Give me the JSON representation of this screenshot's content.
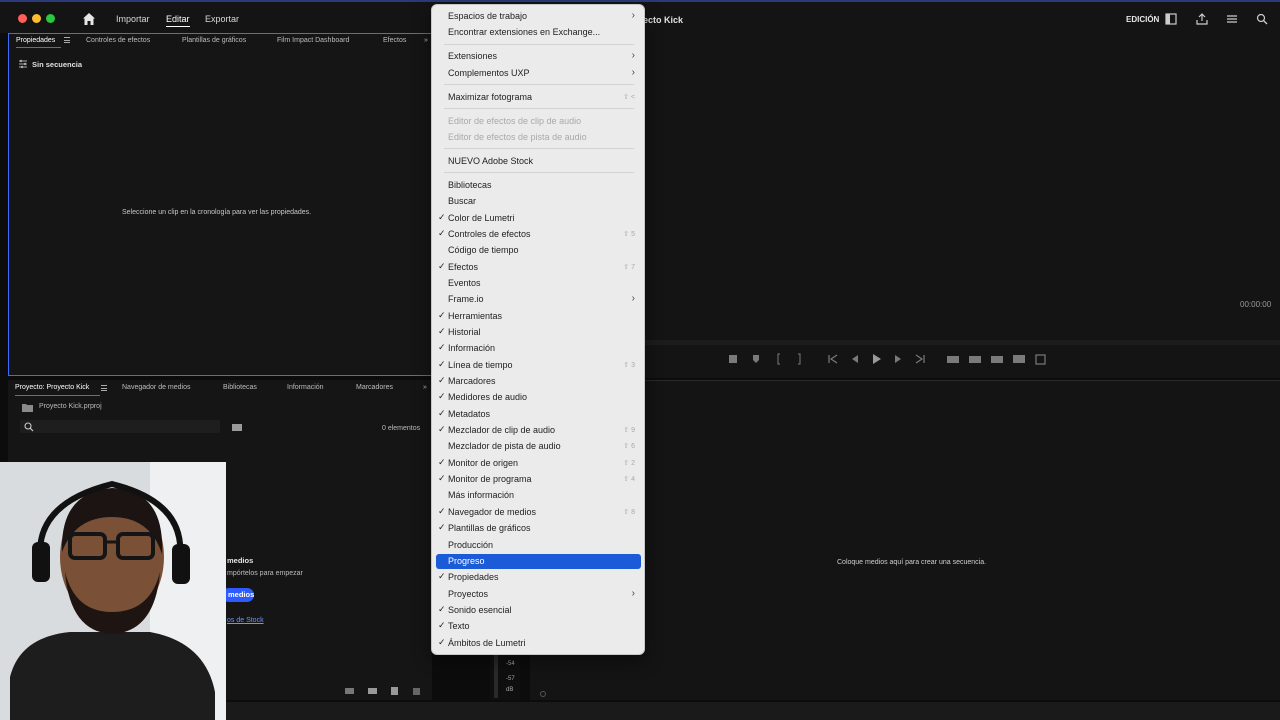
{
  "topbar": {
    "nav": [
      "Importar",
      "Editar",
      "Exportar"
    ],
    "title": "yecto Kick",
    "workspace": "EDICIÓN"
  },
  "props_panel": {
    "tabs": [
      "Propiedades",
      "Controles de efectos",
      "Plantillas de gráficos",
      "Film Impact Dashboard",
      "Efectos"
    ],
    "no_sequence": "Sin secuencia",
    "hint": "Seleccione un clip en la cronología para ver las propiedades."
  },
  "project_panel": {
    "tabs": [
      "Proyecto: Proyecto Kick",
      "Navegador de medios",
      "Bibliotecas",
      "Información",
      "Marcadores"
    ],
    "file": "Proyecto Kick.prproj",
    "count": "0 elementos",
    "empty_title": "medios",
    "empty_sub": "mpórtelos para empezar",
    "button": "medios",
    "link": "os de Stock"
  },
  "program": {
    "timecode": "00:00:00"
  },
  "timeline": {
    "hint": "Coloque medios aquí para crear una secuencia.",
    "meter_labels": [
      "-54",
      "-57",
      "dB"
    ]
  },
  "menu": {
    "items": [
      {
        "label": "Espacios de trabajo",
        "check": false,
        "arrow": true,
        "shortcut": "",
        "disabled": false,
        "highlight": false
      },
      {
        "label": "Encontrar extensiones en Exchange...",
        "check": false,
        "arrow": false,
        "shortcut": "",
        "disabled": false,
        "highlight": false
      },
      {
        "label": "Extensiones",
        "check": false,
        "arrow": true,
        "shortcut": "",
        "disabled": false,
        "highlight": false
      },
      {
        "label": "Complementos UXP",
        "check": false,
        "arrow": true,
        "shortcut": "",
        "disabled": false,
        "highlight": false
      },
      {
        "label": "Maximizar fotograma",
        "check": false,
        "arrow": false,
        "shortcut": "⇧ <",
        "disabled": false,
        "highlight": false
      },
      {
        "label": "Editor de efectos de clip de audio",
        "check": false,
        "arrow": false,
        "shortcut": "",
        "disabled": true,
        "highlight": false
      },
      {
        "label": "Editor de efectos de pista de audio",
        "check": false,
        "arrow": false,
        "shortcut": "",
        "disabled": true,
        "highlight": false
      },
      {
        "label": "NUEVO Adobe Stock",
        "check": false,
        "arrow": false,
        "shortcut": "",
        "disabled": false,
        "highlight": false
      },
      {
        "label": "Bibliotecas",
        "check": false,
        "arrow": false,
        "shortcut": "",
        "disabled": false,
        "highlight": false
      },
      {
        "label": "Buscar",
        "check": false,
        "arrow": false,
        "shortcut": "",
        "disabled": false,
        "highlight": false
      },
      {
        "label": "Color de Lumetri",
        "check": true,
        "arrow": false,
        "shortcut": "",
        "disabled": false,
        "highlight": false
      },
      {
        "label": "Controles de efectos",
        "check": true,
        "arrow": false,
        "shortcut": "⇧ 5",
        "disabled": false,
        "highlight": false
      },
      {
        "label": "Código de tiempo",
        "check": false,
        "arrow": false,
        "shortcut": "",
        "disabled": false,
        "highlight": false
      },
      {
        "label": "Efectos",
        "check": true,
        "arrow": false,
        "shortcut": "⇧ 7",
        "disabled": false,
        "highlight": false
      },
      {
        "label": "Eventos",
        "check": false,
        "arrow": false,
        "shortcut": "",
        "disabled": false,
        "highlight": false
      },
      {
        "label": "Frame.io",
        "check": false,
        "arrow": true,
        "shortcut": "",
        "disabled": false,
        "highlight": false
      },
      {
        "label": "Herramientas",
        "check": true,
        "arrow": false,
        "shortcut": "",
        "disabled": false,
        "highlight": false
      },
      {
        "label": "Historial",
        "check": true,
        "arrow": false,
        "shortcut": "",
        "disabled": false,
        "highlight": false
      },
      {
        "label": "Información",
        "check": true,
        "arrow": false,
        "shortcut": "",
        "disabled": false,
        "highlight": false
      },
      {
        "label": "Línea de tiempo",
        "check": true,
        "arrow": false,
        "shortcut": "⇧ 3",
        "disabled": false,
        "highlight": false
      },
      {
        "label": "Marcadores",
        "check": true,
        "arrow": false,
        "shortcut": "",
        "disabled": false,
        "highlight": false
      },
      {
        "label": "Medidores de audio",
        "check": true,
        "arrow": false,
        "shortcut": "",
        "disabled": false,
        "highlight": false
      },
      {
        "label": "Metadatos",
        "check": true,
        "arrow": false,
        "shortcut": "",
        "disabled": false,
        "highlight": false
      },
      {
        "label": "Mezclador de clip de audio",
        "check": true,
        "arrow": false,
        "shortcut": "⇧ 9",
        "disabled": false,
        "highlight": false
      },
      {
        "label": "Mezclador de pista de audio",
        "check": false,
        "arrow": false,
        "shortcut": "⇧ 6",
        "disabled": false,
        "highlight": false
      },
      {
        "label": "Monitor de origen",
        "check": true,
        "arrow": false,
        "shortcut": "⇧ 2",
        "disabled": false,
        "highlight": false
      },
      {
        "label": "Monitor de programa",
        "check": true,
        "arrow": false,
        "shortcut": "⇧ 4",
        "disabled": false,
        "highlight": false
      },
      {
        "label": "Más información",
        "check": false,
        "arrow": false,
        "shortcut": "",
        "disabled": false,
        "highlight": false
      },
      {
        "label": "Navegador de medios",
        "check": true,
        "arrow": false,
        "shortcut": "⇧ 8",
        "disabled": false,
        "highlight": false
      },
      {
        "label": "Plantillas de gráficos",
        "check": true,
        "arrow": false,
        "shortcut": "",
        "disabled": false,
        "highlight": false
      },
      {
        "label": "Producción",
        "check": false,
        "arrow": false,
        "shortcut": "",
        "disabled": false,
        "highlight": false
      },
      {
        "label": "Progreso",
        "check": false,
        "arrow": false,
        "shortcut": "",
        "disabled": false,
        "highlight": true
      },
      {
        "label": "Propiedades",
        "check": true,
        "arrow": false,
        "shortcut": "",
        "disabled": false,
        "highlight": false
      },
      {
        "label": "Proyectos",
        "check": false,
        "arrow": true,
        "shortcut": "",
        "disabled": false,
        "highlight": false
      },
      {
        "label": "Sonido esencial",
        "check": true,
        "arrow": false,
        "shortcut": "",
        "disabled": false,
        "highlight": false
      },
      {
        "label": "Texto",
        "check": true,
        "arrow": false,
        "shortcut": "",
        "disabled": false,
        "highlight": false
      },
      {
        "label": "Ámbitos de Lumetri",
        "check": true,
        "arrow": false,
        "shortcut": "",
        "disabled": false,
        "highlight": false
      }
    ]
  },
  "colors": {
    "accent": "#3b6bff",
    "menu_highlight": "#1b5bd7",
    "menu_bg": "#ebebeb"
  }
}
